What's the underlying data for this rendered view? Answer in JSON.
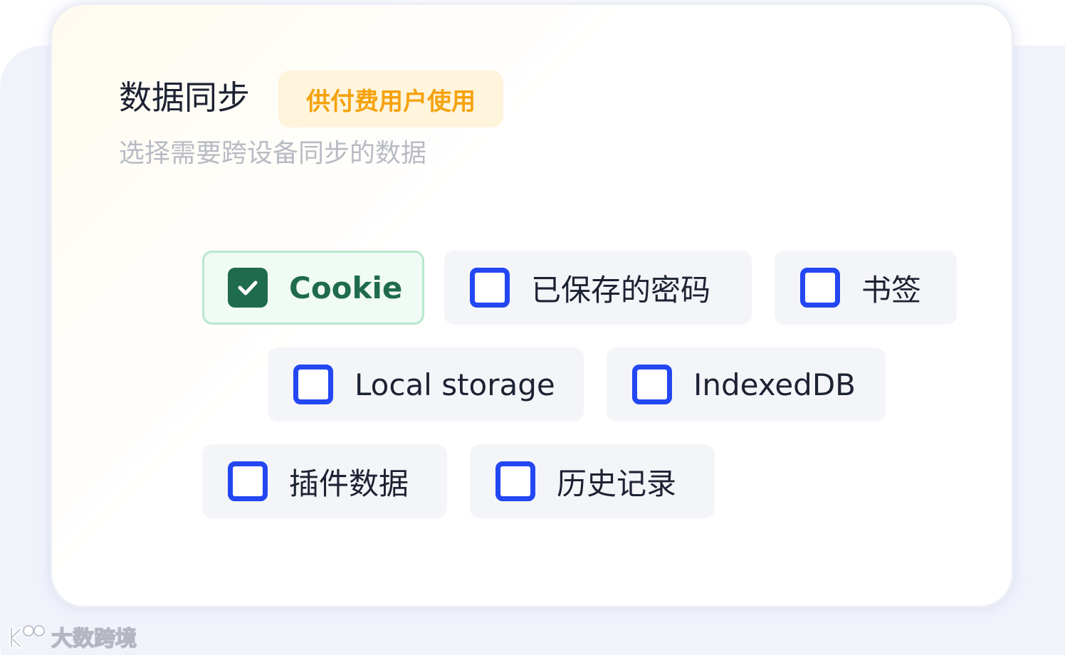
{
  "panel": {
    "title": "数据同步",
    "badge": "供付费用户使用",
    "subtitle": "选择需要跨设备同步的数据"
  },
  "options": [
    {
      "label": "Cookie",
      "checked": true
    },
    {
      "label": "已保存的密码",
      "checked": false
    },
    {
      "label": "书签",
      "checked": false
    },
    {
      "label": "Local storage",
      "checked": false
    },
    {
      "label": "IndexedDB",
      "checked": false
    },
    {
      "label": "插件数据",
      "checked": false
    },
    {
      "label": "历史记录",
      "checked": false
    }
  ],
  "watermark": {
    "text": "大数跨境"
  },
  "colors": {
    "checkbox_unchecked_border": "#2347f2",
    "checkbox_checked_fill": "#1f6b4d",
    "checked_option_bg": "#f0fbf5",
    "checked_option_border": "#b7e8cf",
    "option_bg": "#f4f5f8",
    "badge_bg": "#fff4dc",
    "badge_text": "#f5a20d",
    "title_text": "#1d2233",
    "subtitle_text": "#b8bbc4"
  },
  "icons": {
    "checked_mark": "check-icon",
    "watermark_logo": "brand-logo-icon"
  }
}
